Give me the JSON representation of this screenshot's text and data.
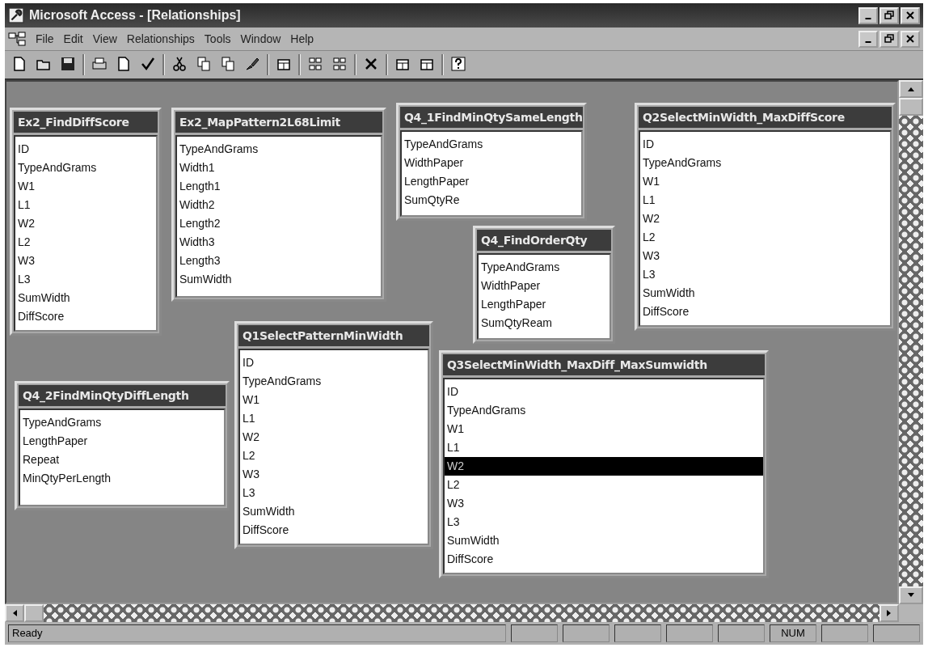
{
  "window": {
    "title": "Microsoft Access - [Relationships]"
  },
  "menu": [
    "File",
    "Edit",
    "View",
    "Relationships",
    "Tools",
    "Window",
    "Help"
  ],
  "tables": [
    {
      "title": "Ex2_FindDiffScore",
      "fields": [
        {
          "name": "ID",
          "selected": false
        },
        {
          "name": "TypeAndGrams",
          "selected": false
        },
        {
          "name": "W1",
          "selected": false
        },
        {
          "name": "L1",
          "selected": false
        },
        {
          "name": "W2",
          "selected": false
        },
        {
          "name": "L2",
          "selected": false
        },
        {
          "name": "W3",
          "selected": false
        },
        {
          "name": "L3",
          "selected": false
        },
        {
          "name": "SumWidth",
          "selected": false
        },
        {
          "name": "DiffScore",
          "selected": false
        }
      ]
    },
    {
      "title": "Ex2_MapPattern2L68Limit",
      "fields": [
        {
          "name": "TypeAndGrams",
          "selected": false
        },
        {
          "name": "Width1",
          "selected": false
        },
        {
          "name": "Length1",
          "selected": false
        },
        {
          "name": "Width2",
          "selected": false
        },
        {
          "name": "Length2",
          "selected": false
        },
        {
          "name": "Width3",
          "selected": false
        },
        {
          "name": "Length3",
          "selected": false
        },
        {
          "name": "SumWidth",
          "selected": false
        }
      ]
    },
    {
      "title": "Q4_1FindMinQtySameLength",
      "fields": [
        {
          "name": "TypeAndGrams",
          "selected": false
        },
        {
          "name": "WidthPaper",
          "selected": false
        },
        {
          "name": "LengthPaper",
          "selected": false
        },
        {
          "name": "SumQtyRe",
          "selected": false
        }
      ]
    },
    {
      "title": "Q4_FindOrderQty",
      "fields": [
        {
          "name": "TypeAndGrams",
          "selected": false
        },
        {
          "name": "WidthPaper",
          "selected": false
        },
        {
          "name": "LengthPaper",
          "selected": false
        },
        {
          "name": "SumQtyReam",
          "selected": false
        }
      ]
    },
    {
      "title": "Q2SelectMinWidth_MaxDiffScore",
      "fields": [
        {
          "name": "ID",
          "selected": false
        },
        {
          "name": "TypeAndGrams",
          "selected": false
        },
        {
          "name": "W1",
          "selected": false
        },
        {
          "name": "L1",
          "selected": false
        },
        {
          "name": "W2",
          "selected": false
        },
        {
          "name": "L2",
          "selected": false
        },
        {
          "name": "W3",
          "selected": false
        },
        {
          "name": "L3",
          "selected": false
        },
        {
          "name": "SumWidth",
          "selected": false
        },
        {
          "name": "DiffScore",
          "selected": false
        }
      ]
    },
    {
      "title": "Q4_2FindMinQtyDiffLength",
      "fields": [
        {
          "name": "TypeAndGrams",
          "selected": false
        },
        {
          "name": "LengthPaper",
          "selected": false
        },
        {
          "name": "Repeat",
          "selected": false
        },
        {
          "name": "MinQtyPerLength",
          "selected": false
        }
      ]
    },
    {
      "title": "Q1SelectPatternMinWidth",
      "fields": [
        {
          "name": "ID",
          "selected": false
        },
        {
          "name": "TypeAndGrams",
          "selected": false
        },
        {
          "name": "W1",
          "selected": false
        },
        {
          "name": "L1",
          "selected": false
        },
        {
          "name": "W2",
          "selected": false
        },
        {
          "name": "L2",
          "selected": false
        },
        {
          "name": "W3",
          "selected": false
        },
        {
          "name": "L3",
          "selected": false
        },
        {
          "name": "SumWidth",
          "selected": false
        },
        {
          "name": "DiffScore",
          "selected": false
        }
      ]
    },
    {
      "title": "Q3SelectMinWidth_MaxDiff_MaxSumwidth",
      "fields": [
        {
          "name": "ID",
          "selected": false
        },
        {
          "name": "TypeAndGrams",
          "selected": false
        },
        {
          "name": "W1",
          "selected": false
        },
        {
          "name": "L1",
          "selected": false
        },
        {
          "name": "W2",
          "selected": true
        },
        {
          "name": "L2",
          "selected": false
        },
        {
          "name": "W3",
          "selected": false
        },
        {
          "name": "L3",
          "selected": false
        },
        {
          "name": "SumWidth",
          "selected": false
        },
        {
          "name": "DiffScore",
          "selected": false
        }
      ]
    }
  ],
  "status_bar": {
    "message": "Ready",
    "num_lock": "NUM"
  }
}
